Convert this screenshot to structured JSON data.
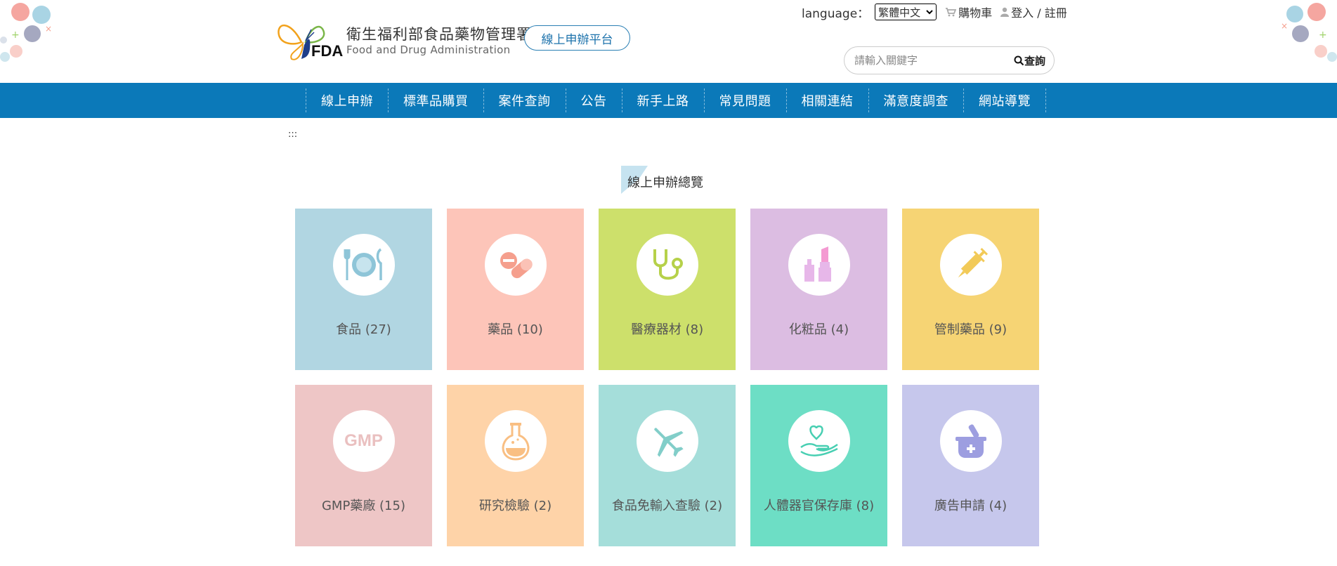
{
  "header": {
    "org_name_cn": "衛生福利部食品藥物管理署",
    "org_name_en": "Food and Drug Administration",
    "logo_text": "FDA",
    "platform_button": "線上申辦平台"
  },
  "top_links": {
    "language_label": "language：",
    "language_selected": "繁體中文",
    "cart": "購物車",
    "login": "登入 / 註冊"
  },
  "search": {
    "placeholder": "請輸入關鍵字",
    "button": "查詢"
  },
  "nav": {
    "items": [
      {
        "label": "線上申辦"
      },
      {
        "label": "標準品購買"
      },
      {
        "label": "案件查詢"
      },
      {
        "label": "公告"
      },
      {
        "label": "新手上路"
      },
      {
        "label": "常見問題"
      },
      {
        "label": "相關連結"
      },
      {
        "label": "滿意度調查"
      },
      {
        "label": "網站導覽"
      }
    ]
  },
  "accesskey": ":::",
  "section": {
    "title": "線上申辦總覽"
  },
  "tiles": [
    {
      "label": "食品 (27)",
      "icon": "dining-plate-icon",
      "bg": "#b1d6e2",
      "icon_color": "#8ec5d8"
    },
    {
      "label": "藥品 (10)",
      "icon": "pill-icon",
      "bg": "#fdc5b9",
      "icon_color": "#f59f8d"
    },
    {
      "label": "醫療器材 (8)",
      "icon": "stethoscope-icon",
      "bg": "#cde06b",
      "icon_color": "#b6d14a"
    },
    {
      "label": "化粧品 (4)",
      "icon": "lipstick-icon",
      "bg": "#dcbde2",
      "icon_color": "#e7b7e9"
    },
    {
      "label": "管制藥品 (9)",
      "icon": "syringe-icon",
      "bg": "#f6d474",
      "icon_color": "#f2ca58"
    },
    {
      "label": "GMP藥廠 (15)",
      "icon": "gmp-icon",
      "icon_text": "GMP",
      "bg": "#eec6c6",
      "icon_color": "#eac0c0"
    },
    {
      "label": "研究檢驗 (2)",
      "icon": "flask-icon",
      "bg": "#fed3a8",
      "icon_color": "#f9bf83"
    },
    {
      "label": "食品免輸入查驗 (2)",
      "icon": "airplane-icon",
      "bg": "#a5deda",
      "icon_color": "#82cec9"
    },
    {
      "label": "人體器官保存庫 (8)",
      "icon": "heart-hand-icon",
      "bg": "#6ddec5",
      "icon_color": "#48cfb2"
    },
    {
      "label": "廣告申請 (4)",
      "icon": "mortar-icon",
      "bg": "#c6c7ec",
      "icon_color": "#9d9ee0"
    }
  ]
}
